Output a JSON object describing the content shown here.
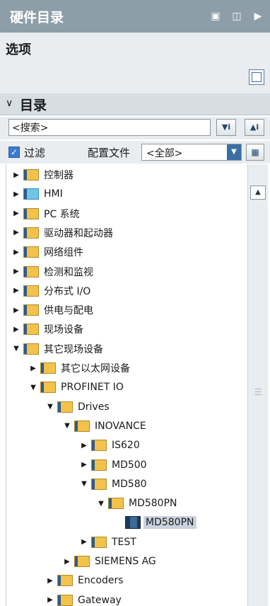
{
  "panel": {
    "title": "硬件目录"
  },
  "options": {
    "label": "选项"
  },
  "catalog": {
    "label": "目录"
  },
  "search": {
    "value": "<搜索>"
  },
  "search_buttons": {
    "down_icon": "search-down-icon",
    "up_icon": "search-up-icon"
  },
  "filter": {
    "checked": true,
    "label": "过滤",
    "profile_label": "配置文件",
    "profile_value": "<全部>"
  },
  "tree": [
    {
      "label": "控制器",
      "expanded": false,
      "icon": "folder-icon"
    },
    {
      "label": "HMI",
      "expanded": false,
      "icon": "folder-hmi-icon"
    },
    {
      "label": "PC 系统",
      "expanded": false,
      "icon": "folder-icon"
    },
    {
      "label": "驱动器和起动器",
      "expanded": false,
      "icon": "folder-icon"
    },
    {
      "label": "网络组件",
      "expanded": false,
      "icon": "folder-icon"
    },
    {
      "label": "检测和监视",
      "expanded": false,
      "icon": "folder-icon"
    },
    {
      "label": "分布式 I/O",
      "expanded": false,
      "icon": "folder-icon"
    },
    {
      "label": "供电与配电",
      "expanded": false,
      "icon": "folder-icon"
    },
    {
      "label": "现场设备",
      "expanded": false,
      "icon": "folder-icon"
    },
    {
      "label": "其它现场设备",
      "expanded": true,
      "icon": "folder-icon"
    },
    {
      "label": "其它以太网设备",
      "expanded": false,
      "icon": "folder-icon"
    },
    {
      "label": "PROFINET IO",
      "expanded": true,
      "icon": "folder-icon"
    },
    {
      "label": "Drives",
      "expanded": true,
      "icon": "folder-icon"
    },
    {
      "label": "INOVANCE",
      "expanded": true,
      "icon": "folder-icon"
    },
    {
      "label": "IS620",
      "expanded": false,
      "icon": "folder-icon"
    },
    {
      "label": "MD500",
      "expanded": false,
      "icon": "folder-icon"
    },
    {
      "label": "MD580",
      "expanded": true,
      "icon": "folder-icon"
    },
    {
      "label": "MD580PN",
      "expanded": true,
      "icon": "folder-icon"
    },
    {
      "label": "MD580PN",
      "expanded": false,
      "icon": "device-icon",
      "selected": true
    },
    {
      "label": "TEST",
      "expanded": false,
      "icon": "folder-icon"
    },
    {
      "label": "SIEMENS AG",
      "expanded": false,
      "icon": "folder-icon"
    },
    {
      "label": "Encoders",
      "expanded": false,
      "icon": "folder-icon"
    },
    {
      "label": "Gateway",
      "expanded": false,
      "icon": "folder-icon"
    }
  ]
}
